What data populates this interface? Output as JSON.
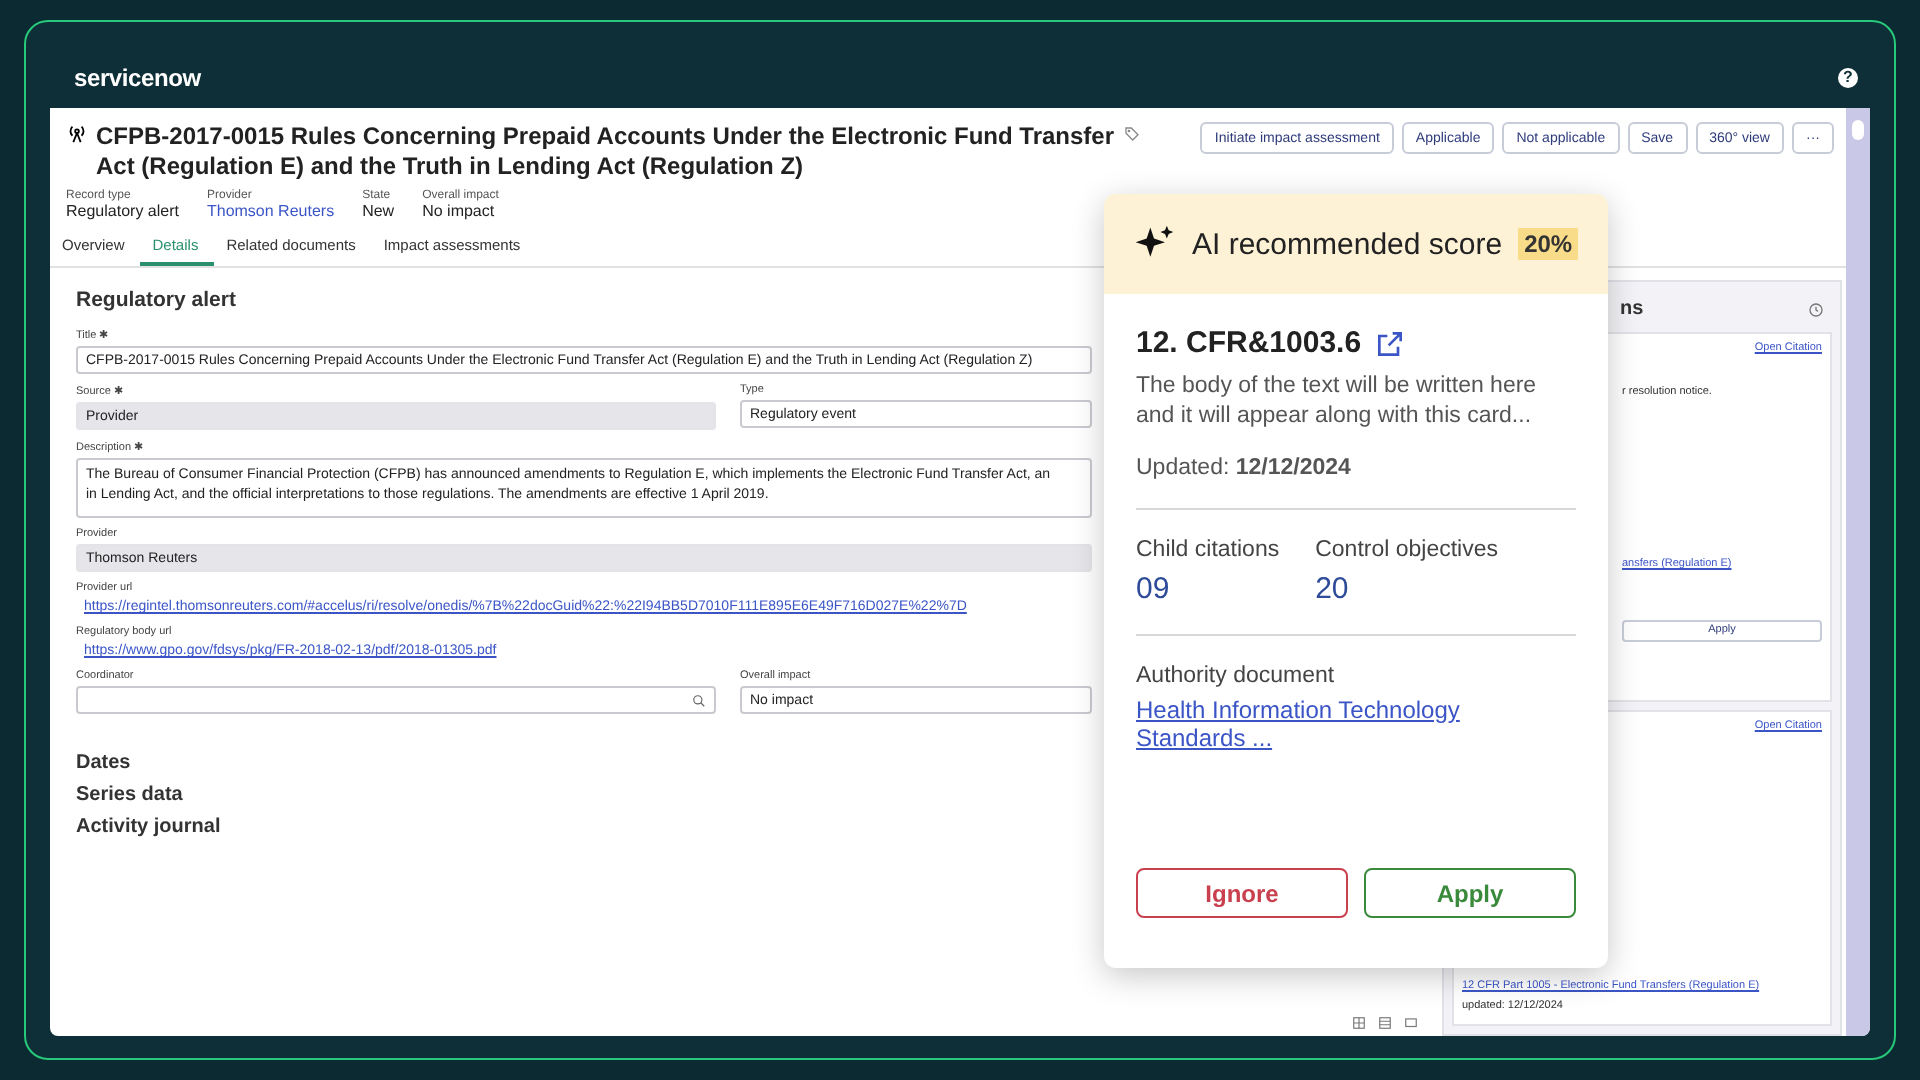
{
  "brand": "servicenow",
  "help": "?",
  "record": {
    "title": "CFPB-2017-0015 Rules Concerning Prepaid Accounts Under the Electronic Fund Transfer Act (Regulation E) and the Truth in Lending Act (Regulation Z)",
    "meta": [
      {
        "label": "Record type",
        "value": "Regulatory alert",
        "kind": "text"
      },
      {
        "label": "Provider",
        "value": "Thomson Reuters",
        "kind": "link"
      },
      {
        "label": "State",
        "value": "New",
        "kind": "text"
      },
      {
        "label": "Overall impact",
        "value": "No impact",
        "kind": "text"
      }
    ]
  },
  "actions": [
    "Initiate impact assessment",
    "Applicable",
    "Not applicable",
    "Save",
    "360° view",
    "···"
  ],
  "tabs": [
    {
      "label": "Overview",
      "selected": false
    },
    {
      "label": "Details",
      "selected": true
    },
    {
      "label": "Related documents",
      "selected": false
    },
    {
      "label": "Impact assessments",
      "selected": false
    }
  ],
  "form": {
    "heading": "Regulatory alert",
    "rows": [
      [
        {
          "label": "Title",
          "mark": "✱",
          "kind": "text",
          "value": "CFPB-2017-0015 Rules Concerning Prepaid Accounts Under the Electronic Fund Transfer Act (Regulation E) and the Truth in Lending Act (Regulation Z)"
        }
      ],
      [
        {
          "label": "Source",
          "mark": "✱",
          "kind": "readonly",
          "value": "Provider"
        },
        {
          "label": "Type",
          "kind": "text",
          "value": "Regulatory event"
        }
      ],
      [
        {
          "label": "Description",
          "mark": "✱",
          "kind": "textarea",
          "lines": [
            "The Bureau of Consumer Financial Protection (CFPB) has announced amendments to Regulation E, which implements the Electronic Fund Transfer Act, an",
            "in Lending Act, and the official interpretations to those regulations. The amendments are effective 1 April 2019."
          ]
        }
      ],
      [
        {
          "label": "Provider",
          "kind": "readonly",
          "value": "Thomson Reuters"
        }
      ],
      [
        {
          "label": "Provider url",
          "kind": "link",
          "value": "https://regintel.thomsonreuters.com/#accelus/ri/resolve/onedis/%7B%22docGuid%22:%22I94BB5D7010F111E895E6E49F716D027E%22%7D"
        }
      ],
      [
        {
          "label": "Regulatory body url",
          "kind": "link",
          "value": "https://www.gpo.gov/fdsys/pkg/FR-2018-02-13/pdf/2018-01305.pdf"
        }
      ],
      [
        {
          "label": "Coordinator",
          "kind": "lookup"
        },
        {
          "label": "Overall impact",
          "kind": "text",
          "value": "No impact"
        }
      ]
    ],
    "sections": [
      "Dates",
      "Series data",
      "Activity journal"
    ]
  },
  "side_panel": {
    "title": "ns",
    "cards": [
      {
        "link": "Open Citation",
        "snippet": "r resolution notice.",
        "citation": "ansfers (Regulation E)",
        "button": "Apply"
      },
      {
        "link": "Open Citation",
        "citation": "12 CFR Part 1005 - Electronic Fund Transfers (Regulation E)",
        "updated": "updated: 12/12/2024"
      }
    ]
  },
  "ai_card": {
    "header": "AI recommended score",
    "score": "20%",
    "code": "12. CFR&1003.6",
    "body": "The body of the text will be written here and it will appear along with this card...",
    "updated": "Updated: **12/12/2024**",
    "stats": [
      {
        "label": "Child citations",
        "value": "09"
      },
      {
        "label": "Control objectives",
        "value": "20"
      }
    ],
    "authority_label": "Authority document",
    "authority_link": "Health Information Technology Standards ...",
    "buttons": [
      {
        "label": "Ignore",
        "kind": "danger"
      },
      {
        "label": "Apply",
        "kind": "success"
      }
    ]
  }
}
